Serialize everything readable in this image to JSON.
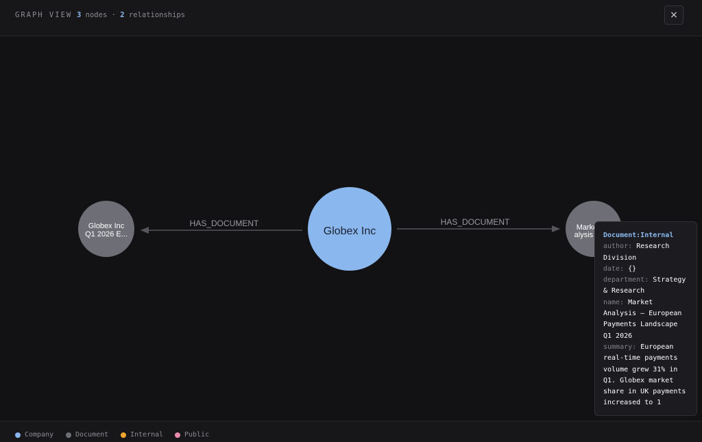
{
  "header": {
    "title": "GRAPH VIEW",
    "node_count": "3",
    "nodes_word": "nodes",
    "separator": "·",
    "relationship_count": "2",
    "relationships_word": "relationships",
    "close_label": "×"
  },
  "graph": {
    "nodes": [
      {
        "id": "doc-left",
        "label_line1": "Globex Inc",
        "label_line2": "Q1 2026 E...",
        "type": "Document"
      },
      {
        "id": "company",
        "label": "Globex Inc",
        "type": "Company"
      },
      {
        "id": "doc-right",
        "label_line1": "Marke",
        "label_line2": "alysis –",
        "type": "Document"
      }
    ],
    "edges": [
      {
        "label": "HAS_DOCUMENT"
      },
      {
        "label": "HAS_DOCUMENT"
      }
    ]
  },
  "tooltip": {
    "header": "Document:Internal",
    "lines": [
      {
        "key": "author:",
        "val": "Research"
      },
      {
        "key": "",
        "val": "Division"
      },
      {
        "key": "date:",
        "val": "{}"
      },
      {
        "key": "department:",
        "val": "Strategy"
      },
      {
        "key": "",
        "val": "& Research"
      },
      {
        "key": "name:",
        "val": "Market"
      },
      {
        "key": "",
        "val": "Analysis — European"
      },
      {
        "key": "",
        "val": "Payments Landscape"
      },
      {
        "key": "",
        "val": "Q1 2026"
      },
      {
        "key": "summary:",
        "val": "European"
      },
      {
        "key": "",
        "val": "real-time payments"
      },
      {
        "key": "",
        "val": "volume grew 31% in"
      },
      {
        "key": "",
        "val": "Q1. Globex market"
      },
      {
        "key": "",
        "val": "share in UK payments"
      },
      {
        "key": "",
        "val": "increased to 1"
      }
    ]
  },
  "legend": [
    {
      "label": "Company",
      "color": "#8ab8ee"
    },
    {
      "label": "Document",
      "color": "#6e6e76"
    },
    {
      "label": "Internal",
      "color": "#f0a62e"
    },
    {
      "label": "Public",
      "color": "#e88aa8"
    }
  ],
  "colors": {
    "company_node": "#8ab8ee",
    "document_node": "#6e6e76",
    "edge": "#55555c"
  }
}
